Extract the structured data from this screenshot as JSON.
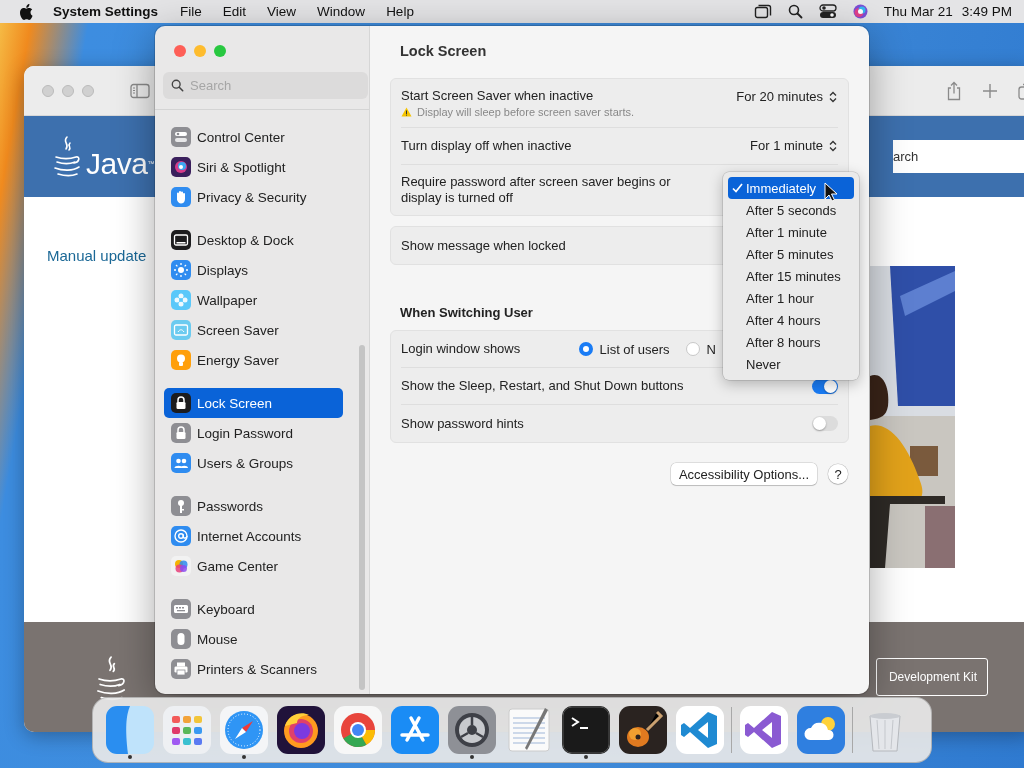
{
  "menu_bar": {
    "app_name": "System Settings",
    "menus": [
      "File",
      "Edit",
      "View",
      "Window",
      "Help"
    ],
    "date": "Thu Mar 21",
    "time": "3:49 PM"
  },
  "browser": {
    "search": {
      "placeholder": "arch"
    },
    "logo_text": "Java$^{™}$",
    "link": "Manual update",
    "footer_button": "Development Kit"
  },
  "settings": {
    "sidebar": {
      "search": {
        "placeholder": "Search"
      },
      "groups": [
        {
          "items": [
            {
              "label": "Control Center",
              "kind": "toggles",
              "color": "#8e8e93",
              "selected": false
            },
            {
              "label": "Siri & Spotlight",
              "kind": "orb",
              "color": "#3a1f5c",
              "selected": false
            },
            {
              "label": "Privacy & Security",
              "kind": "hand",
              "color": "#2f8cf0",
              "selected": false
            }
          ]
        },
        {
          "items": [
            {
              "label": "Desktop & Dock",
              "kind": "dock",
              "color": "#1c1c1e",
              "selected": false
            },
            {
              "label": "Displays",
              "kind": "sun",
              "color": "#2f8cf0",
              "selected": false
            },
            {
              "label": "Wallpaper",
              "kind": "flower",
              "color": "#5ac8fa",
              "selected": false
            },
            {
              "label": "Screen Saver",
              "kind": "screen",
              "color": "#6ccbf0",
              "selected": false
            },
            {
              "label": "Energy Saver",
              "kind": "bulb",
              "color": "#ff9f0a",
              "selected": false
            }
          ]
        },
        {
          "items": [
            {
              "label": "Lock Screen",
              "kind": "lock",
              "color": "#1c1c1e",
              "selected": true
            },
            {
              "label": "Login Password",
              "kind": "lock",
              "color": "#8e8e93",
              "selected": false
            },
            {
              "label": "Users & Groups",
              "kind": "people",
              "color": "#2f8cf0",
              "selected": false
            }
          ]
        },
        {
          "items": [
            {
              "label": "Passwords",
              "kind": "key",
              "color": "#8e8e93",
              "selected": false
            },
            {
              "label": "Internet Accounts",
              "kind": "at",
              "color": "#2f8cf0",
              "selected": false
            },
            {
              "label": "Game Center",
              "kind": "bubbles",
              "color": "#f2f2f2",
              "selected": false
            }
          ]
        },
        {
          "items": [
            {
              "label": "Keyboard",
              "kind": "keyboard",
              "color": "#8e8e93",
              "selected": false
            },
            {
              "label": "Mouse",
              "kind": "mouse",
              "color": "#8e8e93",
              "selected": false
            },
            {
              "label": "Printers & Scanners",
              "kind": "printer",
              "color": "#8e8e93",
              "selected": false
            }
          ]
        }
      ]
    },
    "title": "Lock Screen",
    "cards": [
      {
        "rows": [
          {
            "kind": "select",
            "label": "Start Screen Saver when inactive",
            "note": "Display will sleep before screen saver starts.",
            "value": "For 20 minutes"
          },
          {
            "kind": "select",
            "label": "Turn display off when inactive",
            "value": "For 1 minute"
          },
          {
            "kind": "plain",
            "label": "Require password after screen saver begins or display is turned off"
          }
        ]
      },
      {
        "rows": [
          {
            "kind": "plain",
            "label": "Show message when locked"
          }
        ]
      },
      {
        "heading": "When Switching User",
        "rows": [
          {
            "kind": "radio",
            "label": "Login window shows",
            "options": [
              {
                "label": "List of users",
                "selected": true
              },
              {
                "label": "N",
                "selected": false
              }
            ]
          },
          {
            "kind": "toggle",
            "label": "Show the Sleep, Restart, and Shut Down buttons",
            "on": true
          },
          {
            "kind": "toggle",
            "label": "Show password hints",
            "on": false
          }
        ]
      }
    ],
    "buttons": {
      "accessibility": "Accessibility Options...",
      "help": "?"
    }
  },
  "popup_menu": {
    "items": [
      {
        "label": "Immediately",
        "selected": true,
        "highlighted": true
      },
      {
        "label": "After 5 seconds",
        "selected": false,
        "highlighted": false
      },
      {
        "label": "After 1 minute",
        "selected": false,
        "highlighted": false
      },
      {
        "label": "After 5 minutes",
        "selected": false,
        "highlighted": false
      },
      {
        "label": "After 15 minutes",
        "selected": false,
        "highlighted": false
      },
      {
        "label": "After 1 hour",
        "selected": false,
        "highlighted": false
      },
      {
        "label": "After 4 hours",
        "selected": false,
        "highlighted": false
      },
      {
        "label": "After 8 hours",
        "selected": false,
        "highlighted": false
      },
      {
        "label": "Never",
        "selected": false,
        "highlighted": false
      }
    ]
  },
  "dock": {
    "groups": [
      {
        "apps": [
          {
            "kind": "finder",
            "running": true
          },
          {
            "kind": "launchpad",
            "running": false
          },
          {
            "kind": "safari",
            "running": true
          },
          {
            "kind": "firefox",
            "running": false
          },
          {
            "kind": "chrome",
            "running": false
          },
          {
            "kind": "appstore",
            "running": false
          },
          {
            "kind": "settings",
            "running": true
          },
          {
            "kind": "textedit",
            "running": false
          },
          {
            "kind": "terminal",
            "running": true
          },
          {
            "kind": "garageband",
            "running": false
          },
          {
            "kind": "vscode",
            "running": false
          }
        ]
      },
      {
        "apps": [
          {
            "kind": "vstudio",
            "running": false
          },
          {
            "kind": "weather",
            "running": false
          }
        ]
      },
      {
        "apps": [
          {
            "kind": "trash",
            "running": false
          }
        ]
      }
    ]
  }
}
